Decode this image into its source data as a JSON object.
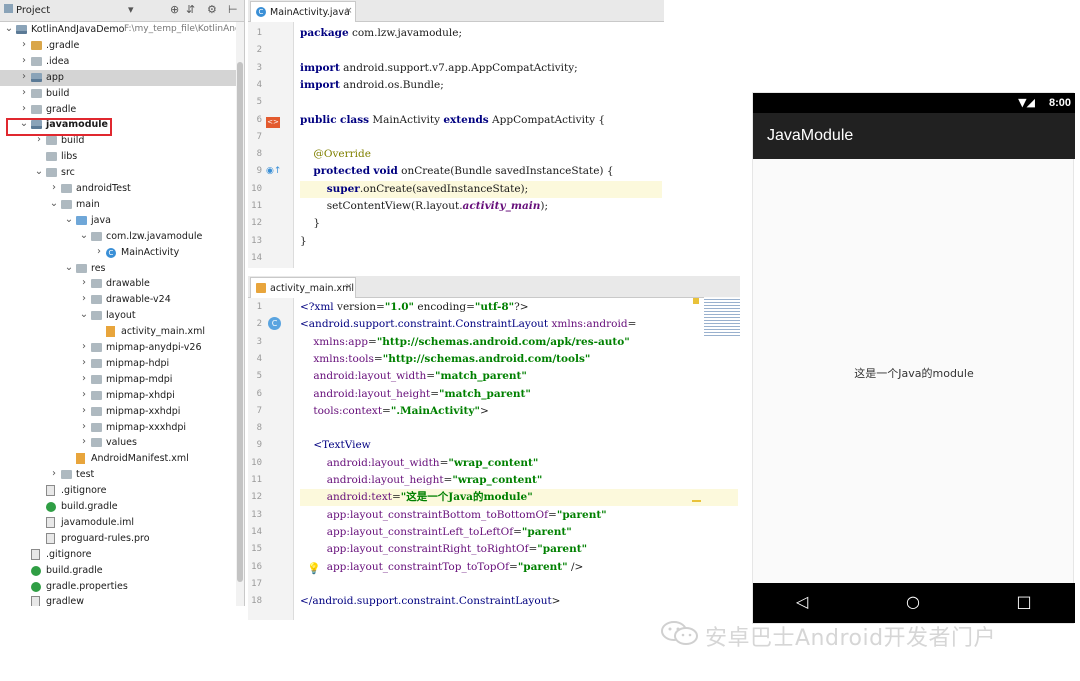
{
  "project_panel": {
    "title": "Project",
    "toolbar_icons": [
      "dropdown-icon",
      "globe-icon",
      "sync-icon",
      "gear-icon",
      "pin-icon"
    ],
    "tree": [
      {
        "label": "KotlinAndJavaDemo",
        "path": "F:\\my_temp_file\\KotlinAndJa",
        "icon": "module",
        "arrow": "down"
      },
      {
        "label": ".gradle",
        "icon": "folder-orange",
        "arrow": "right"
      },
      {
        "label": ".idea",
        "icon": "folder",
        "arrow": "right"
      },
      {
        "label": "app",
        "icon": "module",
        "arrow": "right",
        "selected": true
      },
      {
        "label": "build",
        "icon": "folder",
        "arrow": "right"
      },
      {
        "label": "gradle",
        "icon": "folder",
        "arrow": "right"
      },
      {
        "label": "javamodule",
        "icon": "module",
        "arrow": "down",
        "highlighted": true
      },
      {
        "label": "build",
        "icon": "folder",
        "arrow": "right"
      },
      {
        "label": "libs",
        "icon": "folder",
        "arrow": ""
      },
      {
        "label": "src",
        "icon": "folder",
        "arrow": "down"
      },
      {
        "label": "androidTest",
        "icon": "folder",
        "arrow": "right"
      },
      {
        "label": "main",
        "icon": "folder",
        "arrow": "down"
      },
      {
        "label": "java",
        "icon": "folder-blue",
        "arrow": "down"
      },
      {
        "label": "com.lzw.javamodule",
        "icon": "folder",
        "arrow": "down"
      },
      {
        "label": "MainActivity",
        "icon": "class",
        "arrow": "right"
      },
      {
        "label": "res",
        "icon": "folder",
        "arrow": "down"
      },
      {
        "label": "drawable",
        "icon": "folder",
        "arrow": "right"
      },
      {
        "label": "drawable-v24",
        "icon": "folder",
        "arrow": "right"
      },
      {
        "label": "layout",
        "icon": "folder",
        "arrow": "down"
      },
      {
        "label": "activity_main.xml",
        "icon": "xml",
        "arrow": ""
      },
      {
        "label": "mipmap-anydpi-v26",
        "icon": "folder",
        "arrow": "right"
      },
      {
        "label": "mipmap-hdpi",
        "icon": "folder",
        "arrow": "right"
      },
      {
        "label": "mipmap-mdpi",
        "icon": "folder",
        "arrow": "right"
      },
      {
        "label": "mipmap-xhdpi",
        "icon": "folder",
        "arrow": "right"
      },
      {
        "label": "mipmap-xxhdpi",
        "icon": "folder",
        "arrow": "right"
      },
      {
        "label": "mipmap-xxxhdpi",
        "icon": "folder",
        "arrow": "right"
      },
      {
        "label": "values",
        "icon": "folder",
        "arrow": "right"
      },
      {
        "label": "AndroidManifest.xml",
        "icon": "manifest",
        "arrow": ""
      },
      {
        "label": "test",
        "icon": "folder",
        "arrow": "right"
      },
      {
        "label": ".gitignore",
        "icon": "file",
        "arrow": ""
      },
      {
        "label": "build.gradle",
        "icon": "gradle",
        "arrow": ""
      },
      {
        "label": "javamodule.iml",
        "icon": "file",
        "arrow": ""
      },
      {
        "label": "proguard-rules.pro",
        "icon": "file",
        "arrow": ""
      },
      {
        "label": ".gitignore",
        "icon": "file",
        "arrow": ""
      },
      {
        "label": "build.gradle",
        "icon": "gradle",
        "arrow": ""
      },
      {
        "label": "gradle.properties",
        "icon": "gradle",
        "arrow": ""
      },
      {
        "label": "gradlew",
        "icon": "file",
        "arrow": ""
      }
    ]
  },
  "java_editor": {
    "tab_label": "MainActivity.java",
    "line_numbers": [
      "1",
      "2",
      "3",
      "4",
      "5",
      "6",
      "7",
      "8",
      "9",
      "10",
      "11",
      "12",
      "13",
      "14"
    ],
    "lines": [
      "package com.lzw.javamodule;",
      "",
      "import android.support.v7.app.AppCompatActivity;",
      "import android.os.Bundle;",
      "",
      "public class MainActivity extends AppCompatActivity {",
      "",
      "    @Override",
      "    protected void onCreate(Bundle savedInstanceState) {",
      "        super.onCreate(savedInstanceState);",
      "        setContentView(R.layout.activity_main);",
      "    }",
      "}",
      ""
    ]
  },
  "xml_editor": {
    "tab_label": "activity_main.xml",
    "line_numbers": [
      "1",
      "2",
      "3",
      "4",
      "5",
      "6",
      "7",
      "8",
      "9",
      "10",
      "11",
      "12",
      "13",
      "14",
      "15",
      "16",
      "17",
      "18"
    ],
    "lines": [
      "<?xml version=\"1.0\" encoding=\"utf-8\"?>",
      "<android.support.constraint.ConstraintLayout xmlns:android=",
      "    xmlns:app=\"http://schemas.android.com/apk/res-auto\"",
      "    xmlns:tools=\"http://schemas.android.com/tools\"",
      "    android:layout_width=\"match_parent\"",
      "    android:layout_height=\"match_parent\"",
      "    tools:context=\".MainActivity\">",
      "",
      "    <TextView",
      "        android:layout_width=\"wrap_content\"",
      "        android:layout_height=\"wrap_content\"",
      "        android:text=\"这是一个Java的module\"",
      "        app:layout_constraintBottom_toBottomOf=\"parent\"",
      "        app:layout_constraintLeft_toLeftOf=\"parent\"",
      "        app:layout_constraintRight_toRightOf=\"parent\"",
      "        app:layout_constraintTop_toTopOf=\"parent\" />",
      "",
      "</android.support.constraint.ConstraintLayout>"
    ]
  },
  "device": {
    "status_time": "8:00",
    "app_title": "JavaModule",
    "content_text": "这是一个Java的module",
    "nav_icons": [
      "back-icon",
      "home-icon",
      "recents-icon"
    ]
  },
  "watermark": {
    "text": "安卓巴士Android开发者门户"
  },
  "colors": {
    "highlight_box": "#e0282f",
    "action_bar": "#212121",
    "status_bar": "#000000",
    "keyword": "#000080",
    "string": "#008000"
  }
}
